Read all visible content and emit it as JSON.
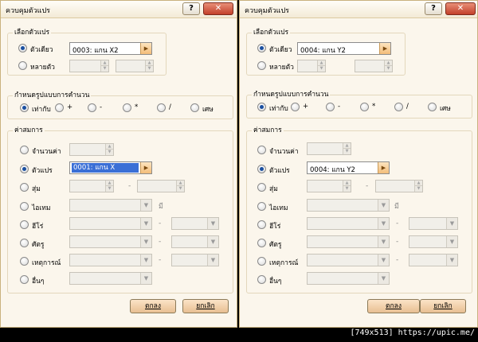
{
  "left": {
    "title": "ควบคุมตัวแปร",
    "help_label": "?",
    "close_label": "✕",
    "select_var": {
      "title": "เลือกตัวแปร",
      "single_label": "ตัวเดียว",
      "single_value": "0003: แกน X2",
      "multi_label": "หลายตัว",
      "selected": "single"
    },
    "calc": {
      "title": "กำหนดรูปแบบการคำนวน",
      "ops": [
        "เท่ากับ",
        "+",
        "-",
        "*",
        "/",
        "เศษ"
      ],
      "selected": "เท่ากับ"
    },
    "operand": {
      "title": "ค่าสมการ",
      "constant_label": "จำนวนค่า",
      "variable_label": "ตัวแปร",
      "variable_value": "0001: แกน X",
      "random_label": "สุ่ม",
      "item_label": "ไอเทม",
      "hero_label": "ฮีโร่",
      "enemy_label": "ศัตรู",
      "event_label": "เหตุการณ์",
      "other_label": "อื่นๆ",
      "dash": "-",
      "item_suffix": "มี",
      "selected": "variable"
    },
    "ok_label": "ตกลง",
    "cancel_label": "ยกเลิก"
  },
  "right": {
    "title": "ควบคุมตัวแปร",
    "help_label": "?",
    "close_label": "✕",
    "select_var": {
      "title": "เลือกตัวแปร",
      "single_label": "ตัวเดียว",
      "single_value": "0004: แกน Y2",
      "multi_label": "หลายตัว",
      "selected": "single"
    },
    "calc": {
      "title": "กำหนดรูปแบบการคำนวน",
      "ops": [
        "เท่ากับ",
        "+",
        "-",
        "*",
        "/",
        "เศษ"
      ],
      "selected": "เท่ากับ"
    },
    "operand": {
      "title": "ค่าสมการ",
      "constant_label": "จำนวนค่า",
      "variable_label": "ตัวแปร",
      "variable_value": "0004: แกน Y2",
      "random_label": "สุ่ม",
      "item_label": "ไอเทม",
      "hero_label": "ฮีโร่",
      "enemy_label": "ศัตรู",
      "event_label": "เหตุการณ์",
      "other_label": "อื่นๆ",
      "dash": "-",
      "item_suffix": "มี",
      "selected": "variable"
    },
    "ok_label": "ตกลง",
    "cancel_label": "ยกเลิก"
  },
  "watermark": "[749x513] https://upic.me/"
}
